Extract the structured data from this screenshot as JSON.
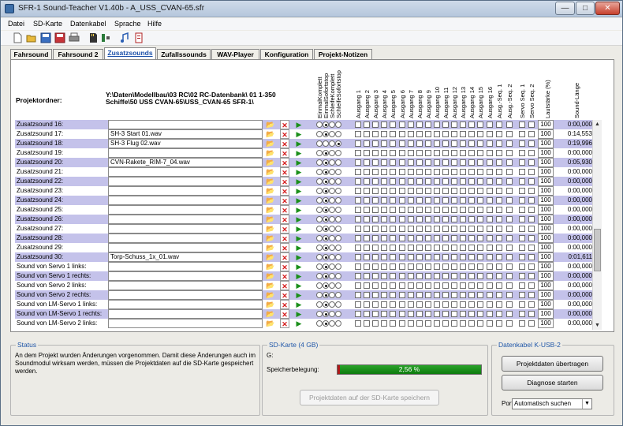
{
  "window": {
    "title": "SFR-1 Sound-Teacher V1.40b - A_USS_CVAN-65.sfr",
    "min_label": "—",
    "max_label": "□",
    "close_label": "✕"
  },
  "menu": [
    "Datei",
    "SD-Karte",
    "Datenkabel",
    "Sprache",
    "Hilfe"
  ],
  "toolbar": {
    "icons": [
      "new-file-icon",
      "open-folder-icon",
      "save-icon",
      "save-as-icon",
      "print-icon",
      "sd-card-icon",
      "cable-icon",
      "info-icon"
    ]
  },
  "tabs": [
    {
      "label": "Fahrsound",
      "active": false
    },
    {
      "label": "Fahrsound 2",
      "active": false
    },
    {
      "label": "Zusatzsounds",
      "active": true
    },
    {
      "label": "Zufallssounds",
      "active": false
    },
    {
      "label": "WAV-Player",
      "active": false
    },
    {
      "label": "Konfiguration",
      "active": false
    },
    {
      "label": "Projekt-Notizen",
      "active": false
    }
  ],
  "project": {
    "label": "Projektordner:",
    "path_line1": "Y:\\Daten\\Modellbau\\03 RC\\02 RC-Datenbank\\ 01 1-350",
    "path_line2": "Schiffe\\50 USS CVAN-65\\USS_CVAN-65 SFR-1\\"
  },
  "columns": {
    "modes": [
      "EinmalKomplett",
      "EinmalSofortstop",
      "SchleifeKomplett",
      "SchleifeSofortstop"
    ],
    "outputs": [
      "Ausgang 1",
      "Ausgang 2",
      "Ausgang 3",
      "Ausgang 4",
      "Ausgang 5",
      "Ausgang 6",
      "Ausgang 7",
      "Ausgang 8",
      "Ausgang 9",
      "Ausgang 10",
      "Ausgang 11",
      "Ausgang 12",
      "Ausgang 13",
      "Ausgang 14",
      "Ausgang 15",
      "Ausgang 16"
    ],
    "seq": [
      "Ausg.-Seq. 1",
      "Ausg.-Seq. 2"
    ],
    "servo": [
      "Servo Seq. 1",
      "Servo Seq. 2"
    ],
    "volume": "Lautstärke (%)",
    "length": "Sound-Länge"
  },
  "rows": [
    {
      "label": "Zusatzsound 16:",
      "file": "",
      "mode": 1,
      "volume": "100",
      "length": "0:00,000",
      "hl": true
    },
    {
      "label": "Zusatzsound 17:",
      "file": "SH-3 Start 01.wav",
      "mode": 1,
      "volume": "100",
      "length": "0:14,553",
      "hl": false
    },
    {
      "label": "Zusatzsound 18:",
      "file": "SH-3 Flug 02.wav",
      "mode": 3,
      "volume": "100",
      "length": "0:19,996",
      "hl": true
    },
    {
      "label": "Zusatzsound 19:",
      "file": "",
      "mode": 1,
      "volume": "100",
      "length": "0:00,000",
      "hl": false
    },
    {
      "label": "Zusatzsound 20:",
      "file": "CVN-Rakete_RIM-7_04.wav",
      "mode": 1,
      "volume": "100",
      "length": "0:05,930",
      "hl": true
    },
    {
      "label": "Zusatzsound 21:",
      "file": "",
      "mode": 1,
      "volume": "100",
      "length": "0:00,000",
      "hl": false
    },
    {
      "label": "Zusatzsound 22:",
      "file": "",
      "mode": 1,
      "volume": "100",
      "length": "0:00,000",
      "hl": true
    },
    {
      "label": "Zusatzsound 23:",
      "file": "",
      "mode": 1,
      "volume": "100",
      "length": "0:00,000",
      "hl": false
    },
    {
      "label": "Zusatzsound 24:",
      "file": "",
      "mode": 1,
      "volume": "100",
      "length": "0:00,000",
      "hl": true
    },
    {
      "label": "Zusatzsound 25:",
      "file": "",
      "mode": 1,
      "volume": "100",
      "length": "0:00,000",
      "hl": false
    },
    {
      "label": "Zusatzsound 26:",
      "file": "",
      "mode": 1,
      "volume": "100",
      "length": "0:00,000",
      "hl": true
    },
    {
      "label": "Zusatzsound 27:",
      "file": "",
      "mode": 1,
      "volume": "100",
      "length": "0:00,000",
      "hl": false
    },
    {
      "label": "Zusatzsound 28:",
      "file": "",
      "mode": 1,
      "volume": "100",
      "length": "0:00,000",
      "hl": true
    },
    {
      "label": "Zusatzsound 29:",
      "file": "",
      "mode": 1,
      "volume": "100",
      "length": "0:00,000",
      "hl": false
    },
    {
      "label": "Zusatzsound 30:",
      "file": "Torp-Schuss_1x_01.wav",
      "mode": 1,
      "volume": "100",
      "length": "0:01,611",
      "hl": true
    },
    {
      "label": "Sound von Servo 1 links:",
      "file": "",
      "mode": 1,
      "volume": "100",
      "length": "0:00,000",
      "hl": false
    },
    {
      "label": "Sound von Servo 1 rechts:",
      "file": "",
      "mode": 1,
      "volume": "100",
      "length": "0:00,000",
      "hl": true
    },
    {
      "label": "Sound von Servo 2 links:",
      "file": "",
      "mode": 1,
      "volume": "100",
      "length": "0:00,000",
      "hl": false
    },
    {
      "label": "Sound von Servo 2 rechts:",
      "file": "",
      "mode": 1,
      "volume": "100",
      "length": "0:00,000",
      "hl": true
    },
    {
      "label": "Sound von LM-Servo 1 links:",
      "file": "",
      "mode": 1,
      "volume": "100",
      "length": "0:00,000",
      "hl": false
    },
    {
      "label": "Sound von LM-Servo 1 rechts:",
      "file": "",
      "mode": 1,
      "volume": "100",
      "length": "0:00,000",
      "hl": true
    },
    {
      "label": "Sound von LM-Servo 2 links:",
      "file": "",
      "mode": 1,
      "volume": "100",
      "length": "0:00,000",
      "hl": false
    }
  ],
  "status": {
    "title": "Status",
    "text": "An dem Projekt wurden Änderungen vorgenommen. Damit diese Änderungen auch im Soundmodul wirksam werden, müssen die Projektdaten auf die SD-Karte gespeichert werden."
  },
  "sdcard": {
    "title": "SD-Karte (4 GB)",
    "drive": "G:",
    "usage_label": "Speicherbelegung:",
    "usage_text": "2,56 %",
    "usage_fraction": 0.0256,
    "save_button": "Projektdaten auf der SD-Karte speichern"
  },
  "cable": {
    "title": "Datenkabel K-USB-2",
    "transfer_button": "Projektdaten übertragen",
    "diag_button": "Diagnose starten",
    "port_label": "Port:",
    "port_value": "Automatisch suchen"
  },
  "colors": {
    "row_highlight": "#c4c2ea",
    "accent": "#1f56a8",
    "bar_green": "#1a9a1a"
  }
}
